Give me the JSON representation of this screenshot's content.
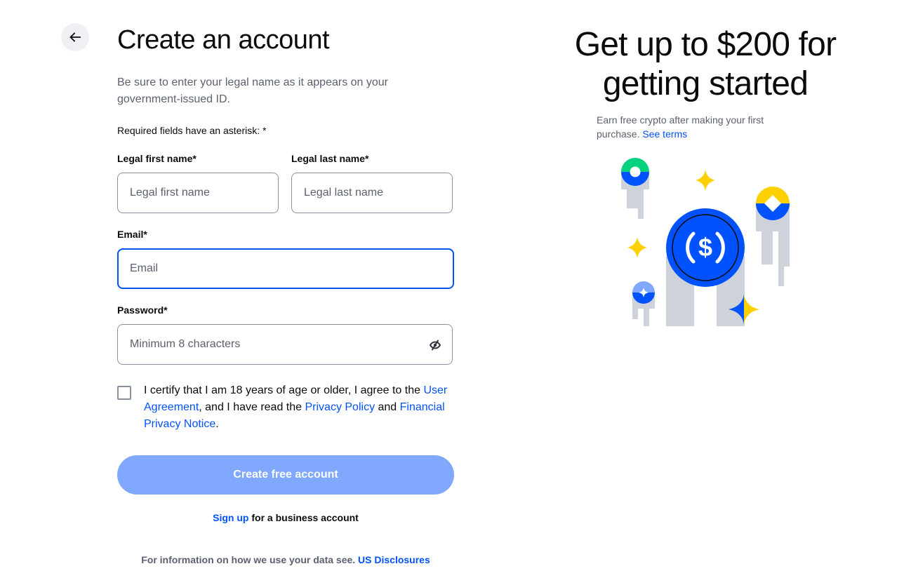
{
  "nav": {
    "back_label": "Back"
  },
  "form": {
    "title": "Create an account",
    "subtitle": "Be sure to enter your legal name as it appears on your government-issued ID.",
    "required_note": "Required fields have an asterisk: *",
    "first_name": {
      "label": "Legal first name*",
      "placeholder": "Legal first name",
      "value": ""
    },
    "last_name": {
      "label": "Legal last name*",
      "placeholder": "Legal last name",
      "value": ""
    },
    "email": {
      "label": "Email*",
      "placeholder": "Email",
      "value": "",
      "focused": true
    },
    "password": {
      "label": "Password*",
      "placeholder": "Minimum 8 characters",
      "value": "",
      "toggle_icon": "eye-slash-icon"
    },
    "consent": {
      "checked": false,
      "text_1": "I certify that I am 18 years of age or older, I agree to the ",
      "link_user_agreement": "User Agreement",
      "text_2": ", and I have read the ",
      "link_privacy_policy": "Privacy Policy",
      "text_3": " and ",
      "link_financial_privacy": "Financial Privacy Notice",
      "text_4": "."
    },
    "submit_label": "Create free account",
    "business": {
      "link": "Sign up",
      "text": " for a business account"
    },
    "disclosure": {
      "text": "For information on how we use your data see. ",
      "link": "US Disclosures"
    }
  },
  "promo": {
    "title": "Get up to $200 for getting started",
    "text": "Earn free crypto after making your first purchase. ",
    "link": "See terms",
    "illustration": "usdc-coin-illustration"
  },
  "colors": {
    "brand_blue": "#0052ff",
    "button_disabled": "#80a8ff",
    "muted_text": "#5b616e",
    "yellow": "#ffd000",
    "green": "#05d17e",
    "gray": "#ced2db"
  }
}
